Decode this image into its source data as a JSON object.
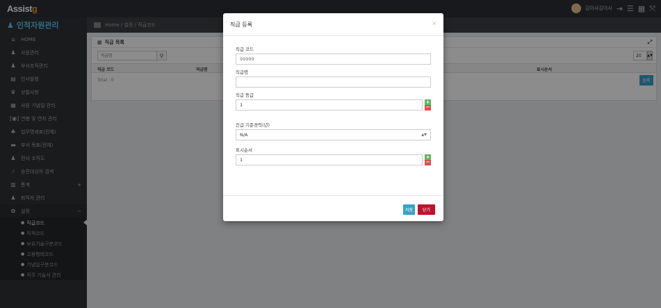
{
  "app": {
    "logo_text": "Assist",
    "logo_accent": "g",
    "brand_title": "인적자원관리",
    "accent_color": "#5dc3f0"
  },
  "topbar": {
    "user_name": "김이사김이사"
  },
  "sidebar": {
    "items": [
      {
        "icon": "home-icon",
        "glyph": "⌂",
        "label": "HOME"
      },
      {
        "icon": "user-icon",
        "glyph": "♟",
        "label": "사원관리"
      },
      {
        "icon": "users-icon",
        "glyph": "♟",
        "label": "부서조직관리"
      },
      {
        "icon": "book-icon",
        "glyph": "▤",
        "label": "인사발령"
      },
      {
        "icon": "trophy-icon",
        "glyph": "♛",
        "label": "상벌사항"
      },
      {
        "icon": "calendar-icon",
        "glyph": "▦",
        "label": "사원 기념일 관리"
      },
      {
        "icon": "code-icon",
        "glyph": "[◉]",
        "label": "연봉 및 연차 관리"
      },
      {
        "icon": "org-icon",
        "glyph": "♣",
        "label": "업무명세표(전체)"
      },
      {
        "icon": "briefcase-icon",
        "glyph": "▬",
        "label": "부서 목표(전체)"
      },
      {
        "icon": "sitemap-icon",
        "glyph": "♟",
        "label": "전사 조직도"
      },
      {
        "icon": "thumbs-up-icon",
        "glyph": "☝",
        "label": "승진대상자 검색"
      },
      {
        "icon": "chart-icon",
        "glyph": "▥",
        "label": "통계",
        "plus": "+"
      },
      {
        "icon": "retire-icon",
        "glyph": "♟",
        "label": "퇴직자 관리"
      },
      {
        "icon": "settings-icon",
        "glyph": "✿",
        "label": "설정",
        "plus": "−"
      }
    ],
    "sub_items": [
      {
        "label": "직급코드",
        "active": true
      },
      {
        "label": "직책코드"
      },
      {
        "label": "보유기술구분코드"
      },
      {
        "label": "고용형태코드"
      },
      {
        "label": "기념일구분코드"
      },
      {
        "label": "직무 기술서 관리"
      }
    ]
  },
  "breadcrumb": {
    "text": "Home / 설정 / 직급코드"
  },
  "panel": {
    "title": "직급 목록",
    "search_placeholder": "직급명",
    "page_size": "20",
    "columns": [
      {
        "label": "직급 코드"
      },
      {
        "label": "직급명"
      },
      {
        "label": "표시순서"
      }
    ],
    "total": "Total : 0",
    "register_label": "등록"
  },
  "modal": {
    "title": "직급 등록",
    "close_glyph": "×",
    "fields": {
      "code": {
        "label": "직급 코드",
        "placeholder": "99999"
      },
      "name": {
        "label": "직급명",
        "value": ""
      },
      "grade": {
        "label": "직급 등급",
        "value": "1"
      },
      "promotion": {
        "label": "진급 기준경력(년)",
        "value": "N/A"
      },
      "order": {
        "label": "표시순서",
        "value": "1"
      }
    },
    "save_label": "저장",
    "close_label": "닫기"
  }
}
